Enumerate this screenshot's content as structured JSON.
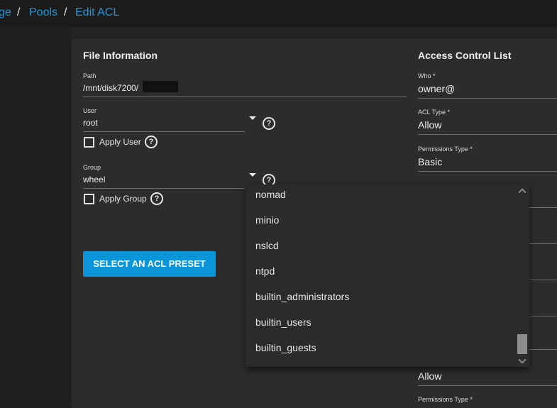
{
  "breadcrumb": {
    "items": [
      "ge",
      "Pools",
      "Edit ACL"
    ],
    "separator": "/"
  },
  "file_info": {
    "title": "File Information",
    "path": {
      "label": "Path",
      "value": "/mnt/disk7200/"
    },
    "user": {
      "label": "User",
      "value": "root",
      "apply_label": "Apply User"
    },
    "group": {
      "label": "Group",
      "value": "wheel",
      "apply_label": "Apply Group"
    },
    "preset_button": "SELECT AN ACL PRESET"
  },
  "acl": {
    "title": "Access Control List",
    "who": {
      "label": "Who *",
      "value": "owner@"
    },
    "acl_type": {
      "label": "ACL Type *",
      "value": "Allow"
    },
    "perm_type": {
      "label": "Permissions Type *",
      "value": "Basic"
    },
    "acl_type_2": {
      "value": "Allow"
    },
    "perm_type_2": {
      "label": "Permissions Type *"
    }
  },
  "group_dropdown": {
    "options": [
      "nomad",
      "minio",
      "nslcd",
      "ntpd",
      "builtin_administrators",
      "builtin_users",
      "builtin_guests"
    ]
  },
  "colors": {
    "accent": "#0b95d9",
    "link": "#1e96d8",
    "card": "#2c2c2c",
    "background": "#1e1e1e"
  }
}
